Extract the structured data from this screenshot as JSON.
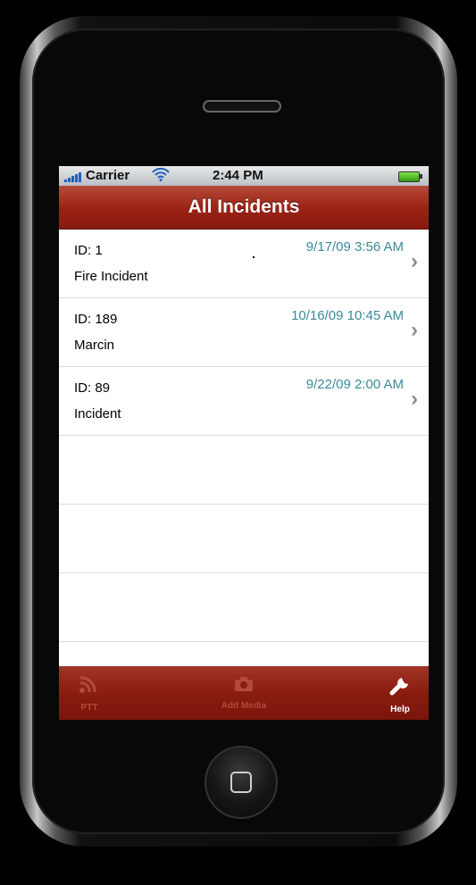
{
  "status_bar": {
    "carrier": "Carrier",
    "time": "2:44 PM"
  },
  "nav": {
    "title": "All Incidents"
  },
  "incidents": [
    {
      "id_label": "ID: 1",
      "name": "Fire Incident",
      "date": "9/17/09 3:56 AM"
    },
    {
      "id_label": "ID: 189",
      "name": "Marcin",
      "date": "10/16/09 10:45 AM"
    },
    {
      "id_label": "ID: 89",
      "name": "Incident",
      "date": "9/22/09 2:00 AM"
    }
  ],
  "tabbar": {
    "items": [
      {
        "label": "PTT",
        "icon": "signal-waves-icon",
        "state": "dim"
      },
      {
        "label": "Add Media",
        "icon": "camera-icon",
        "state": "dim"
      },
      {
        "label": "Help",
        "icon": "wrench-icon",
        "state": "active"
      }
    ]
  },
  "colors": {
    "nav_red": "#9b2416",
    "date_teal": "#3a8a98",
    "tab_dim": "#b14a3c"
  }
}
